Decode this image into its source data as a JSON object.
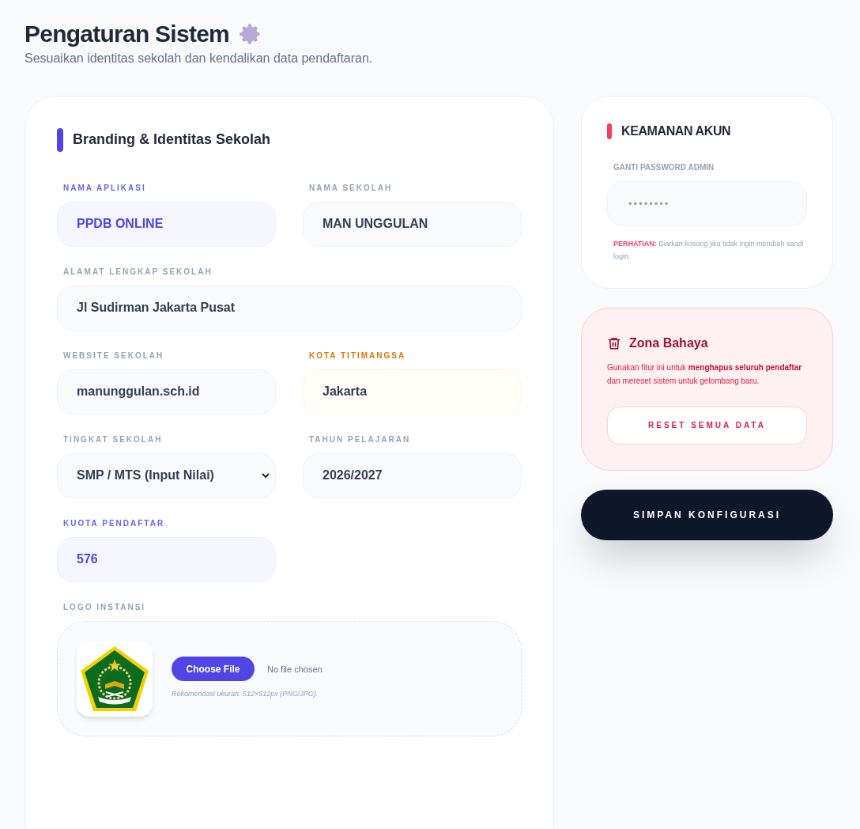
{
  "header": {
    "title": "Pengaturan Sistem",
    "subtitle": "Sesuaikan identitas sekolah dan kendalikan data pendaftaran."
  },
  "branding": {
    "title": "Branding & Identitas Sekolah",
    "fields": [
      {
        "label": "NAMA APLIKASI",
        "value": "PPDB ONLINE",
        "kind": "input",
        "color": "#6366f1"
      },
      {
        "label": "NAMA SEKOLAH",
        "value": "MAN UNGGULAN",
        "kind": "input",
        "color": "#94a3b8"
      },
      {
        "label": "ALAMAT LENGKAP SEKOLAH",
        "value": "Jl Sudirman Jakarta Pusat",
        "kind": "input",
        "color": "#94a3b8"
      },
      {
        "label": "WEBSITE SEKOLAH",
        "value": "manunggulan.sch.id",
        "kind": "input",
        "color": "#94a3b8"
      },
      {
        "label": "KOTA TITIMANGSA",
        "value": "Jakarta",
        "kind": "input",
        "color": "#d97706"
      },
      {
        "label": "TINGKAT SEKOLAH",
        "value": "SMP / MTS (Input Nilai)",
        "kind": "select",
        "color": "#94a3b8"
      },
      {
        "label": "TAHUN PELAJARAN",
        "value": "2026/2027",
        "kind": "input",
        "color": "#94a3b8"
      },
      {
        "label": "KUOTA PENDAFTAR",
        "value": "576",
        "kind": "input",
        "color": "#6366f1"
      }
    ],
    "logo": {
      "label": "LOGO INSTANSI",
      "button": "Choose File",
      "status": "No file chosen",
      "hint": "Rekomendasi ukuran: 512×512px (PNG/JPG)."
    }
  },
  "security": {
    "title": "KEAMANAN AKUN",
    "label": "GANTI PASSWORD ADMIN",
    "value": "••••••••",
    "note": "**PERHATIAN:** Biarkan kosong jika tidak ingin merubah sandi login."
  },
  "danger": {
    "title": "Zona Bahaya",
    "text": "Gunakan fitur ini untuk **menghapus seluruh pendaftar** dan mereset sistem untuk gelombang baru.",
    "button": "RESET SEMUA DATA"
  },
  "save_button": "SIMPAN KONFIGURASI"
}
